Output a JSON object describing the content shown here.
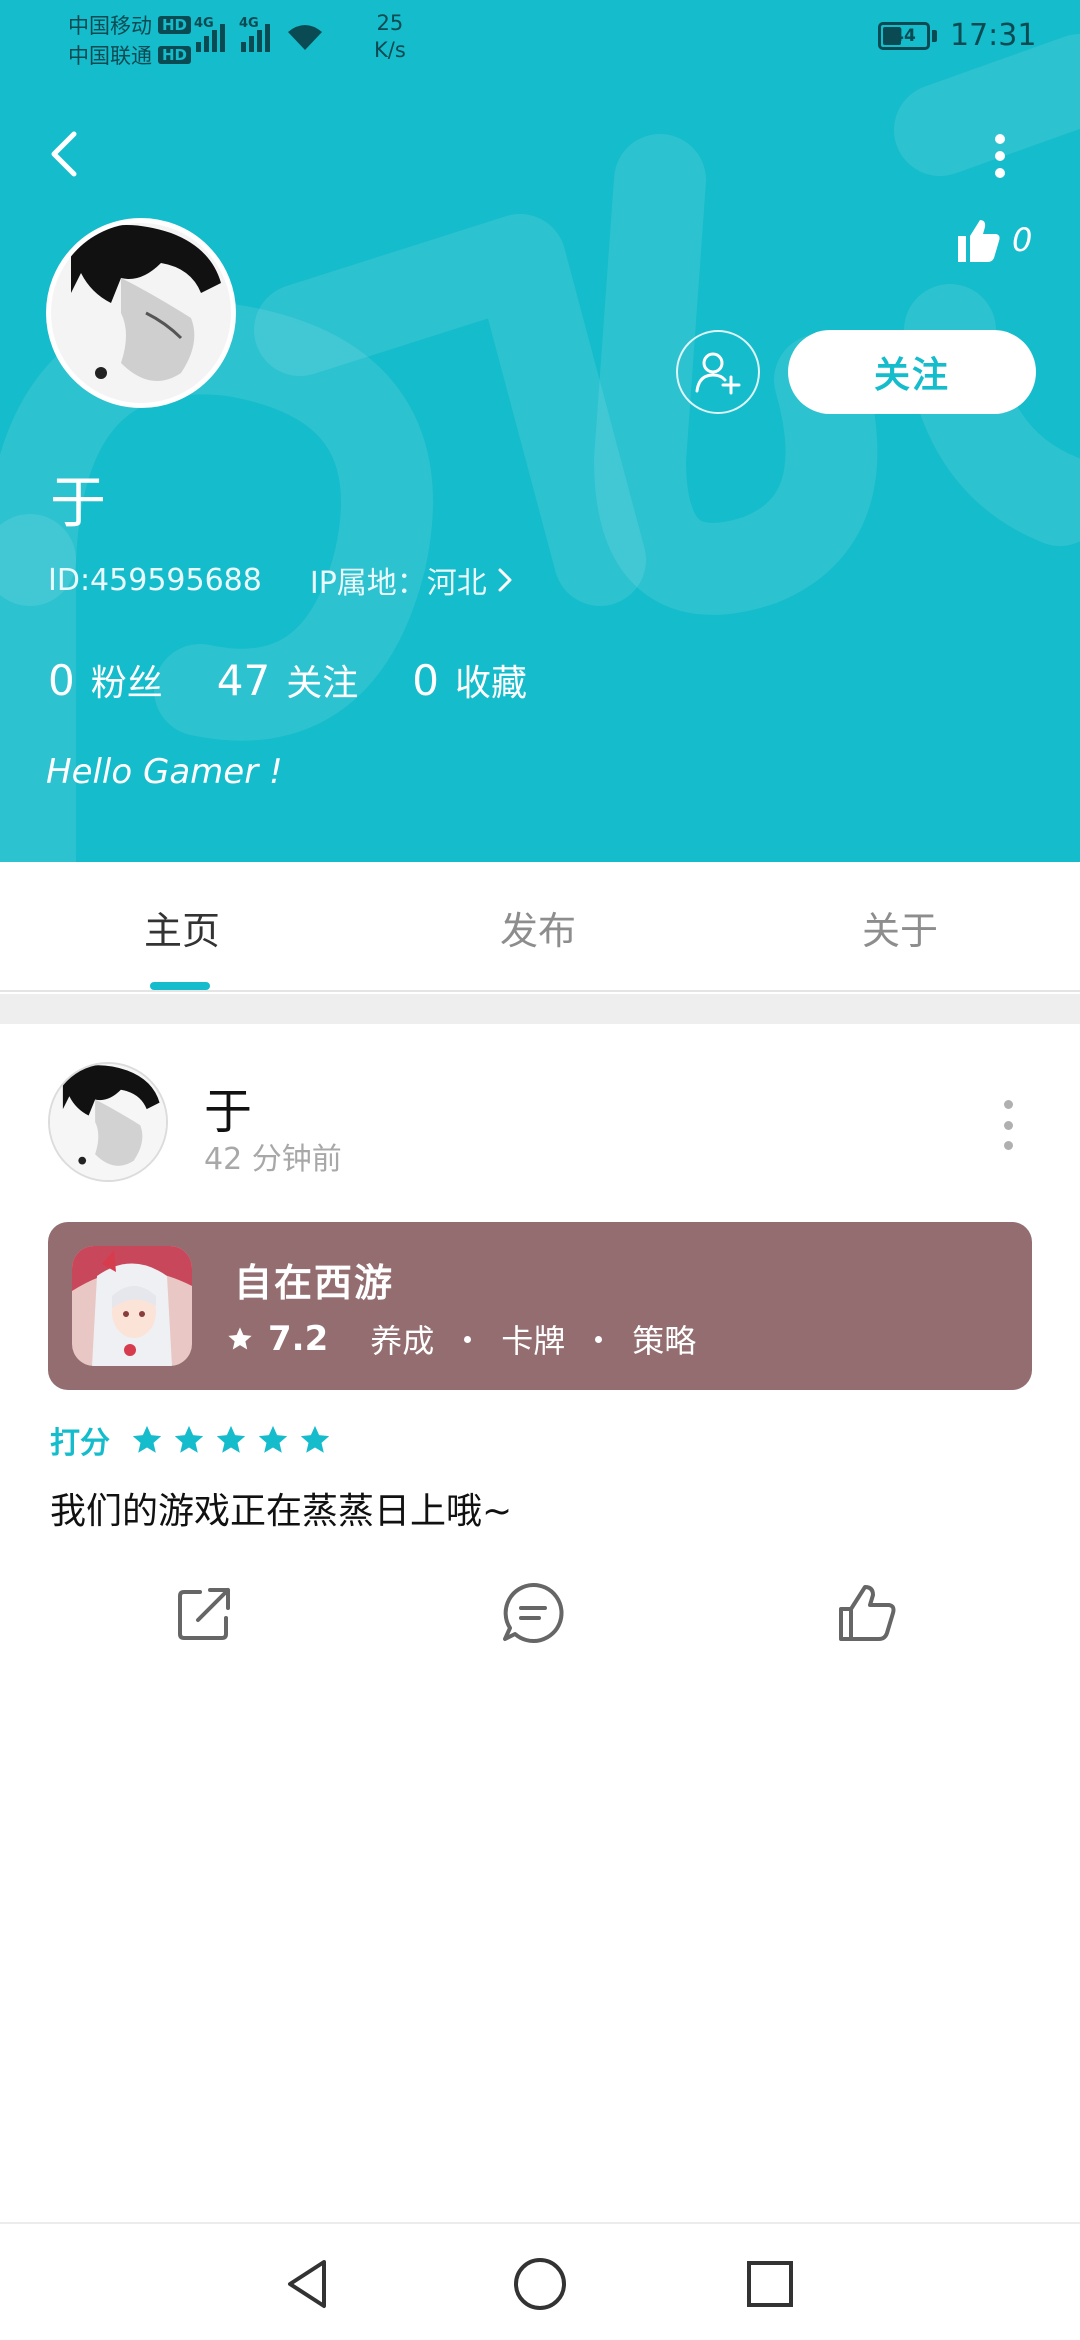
{
  "status_bar": {
    "carrier1": "中国移动",
    "carrier2": "中国联通",
    "hd_badge": "HD",
    "network_type": "4G",
    "speed_value": "25",
    "speed_unit": "K/s",
    "battery": "44",
    "time": "17:31"
  },
  "header": {
    "like_count": "0",
    "follow_label": "关注",
    "username": "于",
    "user_id": "ID:459595688",
    "ip_location": "IP属地：河北",
    "stats": [
      {
        "num": "0",
        "label": "粉丝"
      },
      {
        "num": "47",
        "label": "关注"
      },
      {
        "num": "0",
        "label": "收藏"
      }
    ],
    "bio": "Hello Gamer !"
  },
  "tabs": [
    {
      "label": "主页",
      "active": true
    },
    {
      "label": "发布",
      "active": false
    },
    {
      "label": "关于",
      "active": false
    }
  ],
  "post": {
    "author": "于",
    "time_ago": "42 分钟前",
    "game": {
      "title": "自在西游",
      "score": "7.2",
      "tags": [
        "养成",
        "卡牌",
        "策略"
      ]
    },
    "rating_label": "打分",
    "rating_stars": 5,
    "content": "我们的游戏正在蒸蒸日上哦~"
  },
  "colors": {
    "accent": "#15bccb",
    "game_card": "#936d6f",
    "white": "#ffffff"
  },
  "icons": {
    "back": "back-arrow-icon",
    "more": "more-vertical-icon",
    "like": "thumbs-up-icon",
    "add_friend": "add-friend-icon",
    "star": "star-icon",
    "share": "share-icon",
    "comment": "comment-icon"
  }
}
